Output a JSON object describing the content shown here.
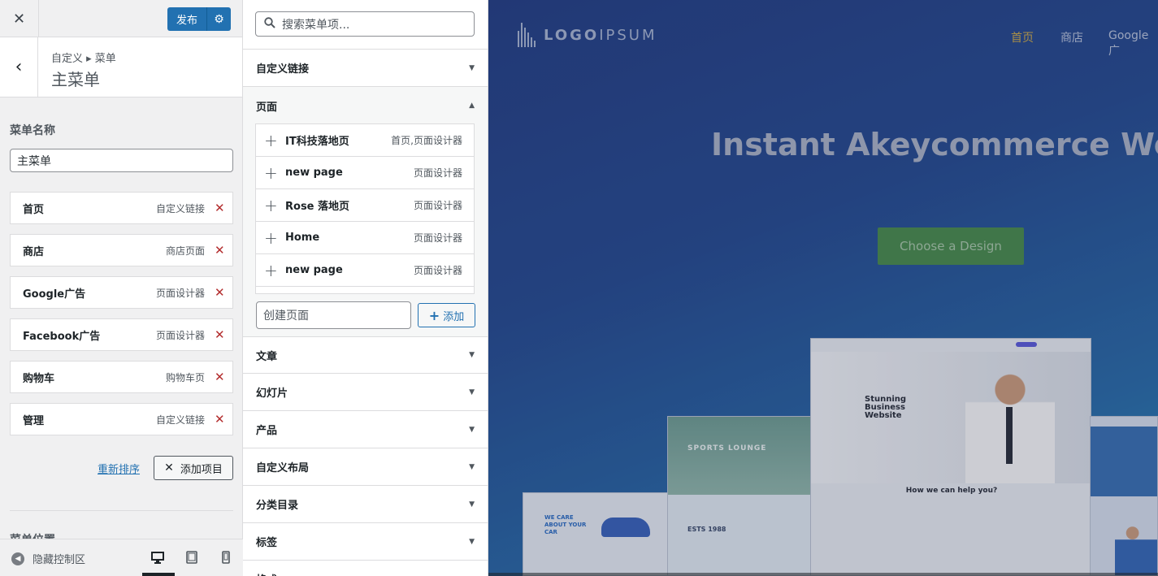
{
  "header": {
    "publish_label": "发布"
  },
  "section": {
    "breadcrumb": "自定义 ▸ 菜单",
    "title": "主菜单"
  },
  "menu_name": {
    "label": "菜单名称",
    "value": "主菜单"
  },
  "menu_items": [
    {
      "title": "首页",
      "type": "自定义链接"
    },
    {
      "title": "商店",
      "type": "商店页面"
    },
    {
      "title": "Google广告",
      "type": "页面设计器"
    },
    {
      "title": "Facebook广告",
      "type": "页面设计器"
    },
    {
      "title": "购物车",
      "type": "购物车页"
    },
    {
      "title": "管理",
      "type": "自定义链接"
    }
  ],
  "actions": {
    "reorder": "重新排序",
    "add_items": "添加项目"
  },
  "menu_locations_label": "菜单位置",
  "footer": {
    "hide_controls": "隐藏控制区"
  },
  "available": {
    "search_placeholder": "搜索菜单项...",
    "sections": {
      "custom_links": "自定义链接",
      "pages": "页面",
      "posts": "文章",
      "slides": "幻灯片",
      "products": "产品",
      "custom_layouts": "自定义布局",
      "categories": "分类目录",
      "tags": "标签",
      "formats": "格式"
    },
    "pages": [
      {
        "title": "IT科技落地页",
        "type": "首页,页面设计器"
      },
      {
        "title": "new page",
        "type": "页面设计器"
      },
      {
        "title": "Rose 落地页",
        "type": "页面设计器"
      },
      {
        "title": "Home",
        "type": "页面设计器"
      },
      {
        "title": "new page",
        "type": "页面设计器"
      }
    ],
    "new_page_placeholder": "创建页面",
    "add_label": "添加"
  },
  "preview": {
    "logo_bold": "LOGO",
    "logo_light": "IPSUM",
    "nav": [
      "首页",
      "商店",
      "Google广"
    ],
    "hero_title": "Instant Akeycommerce Websit",
    "cta": "Choose a Design",
    "thumb_main_title": "Stunning Business Website",
    "thumb_main_help": "How we can help you?",
    "thumb_sports_label": "SPORTS LOUNGE",
    "thumb_sports_year": "ESTS 1988",
    "thumb_car_text": "WE CARE ABOUT YOUR CAR"
  },
  "colors": {
    "accent": "#2271b1",
    "delete": "#b32d2e",
    "nav_active": "#c8a84a",
    "cta": "#4a8a4c"
  }
}
